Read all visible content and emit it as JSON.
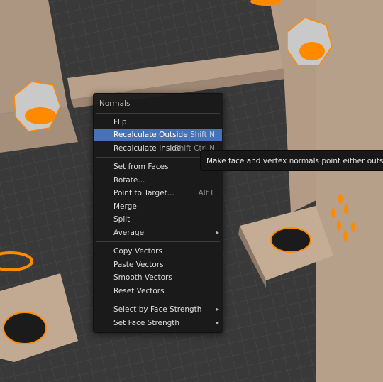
{
  "menu": {
    "title": "Normals",
    "items": [
      {
        "label": "Flip",
        "shortcut": ""
      },
      {
        "label": "Recalculate Outside",
        "shortcut": "Shift N"
      },
      {
        "label": "Recalculate Inside",
        "shortcut": "Shift Ctrl N"
      },
      {
        "label": "Set from Faces",
        "shortcut": ""
      },
      {
        "label": "Rotate...",
        "shortcut": ""
      },
      {
        "label": "Point to Target...",
        "shortcut": "Alt L"
      },
      {
        "label": "Merge",
        "shortcut": ""
      },
      {
        "label": "Split",
        "shortcut": ""
      },
      {
        "label": "Average",
        "shortcut": "",
        "submenu": "▸"
      },
      {
        "label": "Copy Vectors",
        "shortcut": ""
      },
      {
        "label": "Paste Vectors",
        "shortcut": ""
      },
      {
        "label": "Smooth Vectors",
        "shortcut": ""
      },
      {
        "label": "Reset Vectors",
        "shortcut": ""
      },
      {
        "label": "Select by Face Strength",
        "shortcut": "",
        "submenu": "▸"
      },
      {
        "label": "Set Face Strength",
        "shortcut": "",
        "submenu": "▸"
      }
    ]
  },
  "tooltip": {
    "text": "Make face and vertex normals point either outside or inside the mesh"
  },
  "colors": {
    "highlight": "#4772b3",
    "selection": "#ff8a00",
    "mesh": "#b49c86",
    "grid_bg": "#3a3a3a"
  }
}
